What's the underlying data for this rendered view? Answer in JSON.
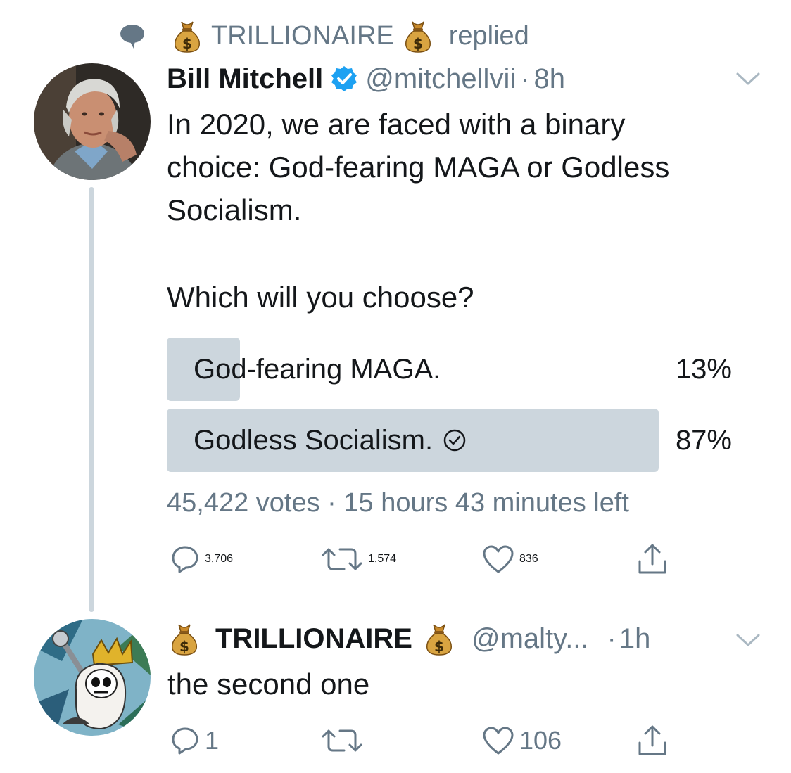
{
  "context": {
    "name": "TRILLIONAIRE",
    "action": "replied"
  },
  "main_tweet": {
    "name": "Bill Mitchell",
    "handle": "@mitchellvii",
    "sep": "·",
    "time": "8h",
    "text_line1": "In 2020, we are faced with a binary",
    "text_line2": "choice: God-fearing MAGA or Godless",
    "text_line3": "Socialism.",
    "question": "Which will you choose?",
    "poll": [
      {
        "label": "God-fearing MAGA.",
        "percent_text": "13%",
        "fraction": 0.13,
        "selected": false
      },
      {
        "label": "Godless Socialism.",
        "percent_text": "87%",
        "fraction": 0.87,
        "selected": true
      }
    ],
    "votes": "45,422 votes",
    "meta_sep": "·",
    "time_left": "15 hours 43 minutes left",
    "replies": "3,706",
    "retweets": "1,574",
    "likes": "836"
  },
  "reply_tweet": {
    "name": "TRILLIONAIRE",
    "handle": "@malty...",
    "sep": "·",
    "time": "1h",
    "text": "the second one",
    "replies": "1",
    "retweets": "",
    "likes": "106"
  },
  "colors": {
    "text": "#14171a",
    "secondary": "#657786",
    "poll_fill": "#ccd6dd",
    "verified": "#1da1f2",
    "line": "#ccd6dd"
  }
}
